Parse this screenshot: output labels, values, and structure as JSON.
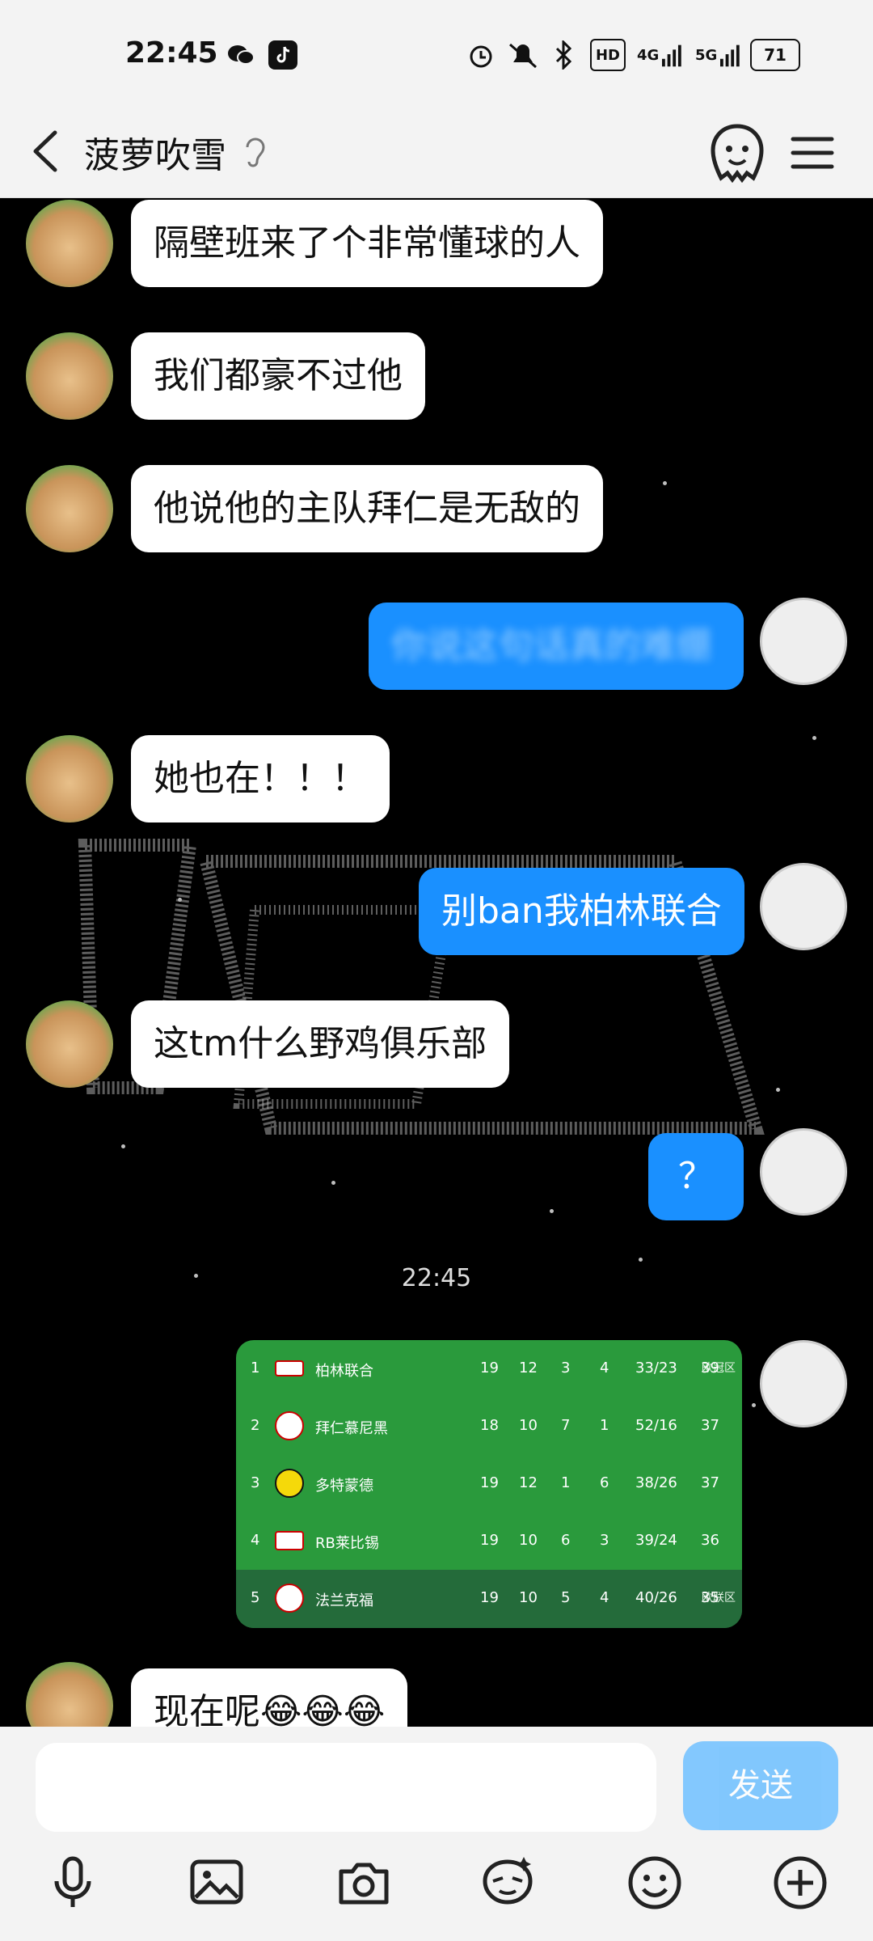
{
  "status_bar": {
    "time": "22:45",
    "network_4g": "4G",
    "network_5g": "5G",
    "hd_label": "HD",
    "battery": "71"
  },
  "header": {
    "title": "菠萝吹雪"
  },
  "messages": [
    {
      "side": "in",
      "text": "隔壁班来了个非常懂球的人"
    },
    {
      "side": "in",
      "text": "我们都豪不过他"
    },
    {
      "side": "in",
      "text": "他说他的主队拜仁是无敌的"
    },
    {
      "side": "out",
      "text": "你说这句话真的难绷"
    },
    {
      "side": "in",
      "text": "她也在！！！"
    },
    {
      "side": "out",
      "text": "别ban我柏林联合"
    },
    {
      "side": "in",
      "text": "这tm什么野鸡俱乐部"
    },
    {
      "side": "out",
      "text": "？"
    },
    {
      "side": "in",
      "text": "现在呢😂😂😂"
    }
  ],
  "timestamp": "22:45",
  "standings": {
    "zone_top": "欧冠区",
    "zone_bottom": "欧联区",
    "rows": [
      {
        "rank": "1",
        "team": "柏林联合",
        "played": "19",
        "w": "12",
        "d": "3",
        "l": "4",
        "goals": "33/23",
        "pts": "39"
      },
      {
        "rank": "2",
        "team": "拜仁慕尼黑",
        "played": "18",
        "w": "10",
        "d": "7",
        "l": "1",
        "goals": "52/16",
        "pts": "37"
      },
      {
        "rank": "3",
        "team": "多特蒙德",
        "played": "19",
        "w": "12",
        "d": "1",
        "l": "6",
        "goals": "38/26",
        "pts": "37"
      },
      {
        "rank": "4",
        "team": "RB莱比锡",
        "played": "19",
        "w": "10",
        "d": "6",
        "l": "3",
        "goals": "39/24",
        "pts": "36"
      },
      {
        "rank": "5",
        "team": "法兰克福",
        "played": "19",
        "w": "10",
        "d": "5",
        "l": "4",
        "goals": "40/26",
        "pts": "35"
      }
    ]
  },
  "input": {
    "placeholder": "",
    "send_label": "发送"
  }
}
